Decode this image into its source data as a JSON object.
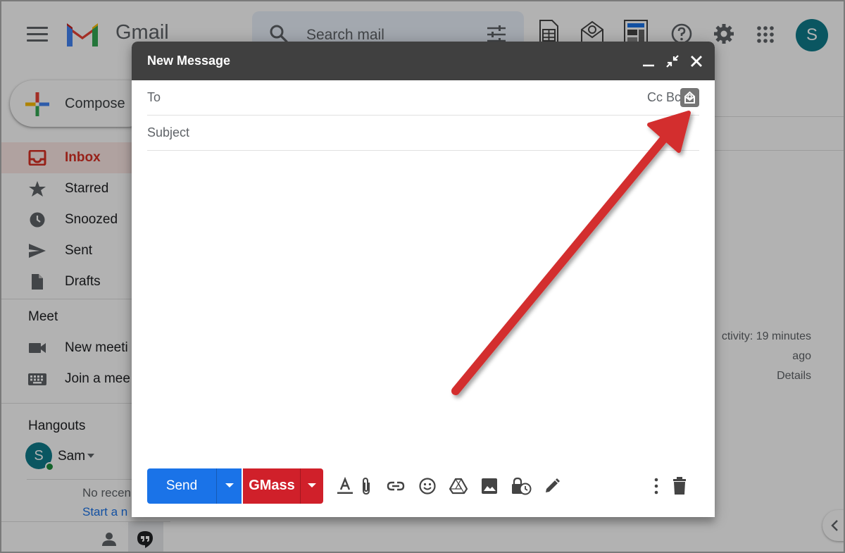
{
  "app": {
    "logo_text": "Gmail",
    "search_placeholder": "Search mail",
    "avatar_letter": "S"
  },
  "sidebar": {
    "compose_label": "Compose",
    "items": [
      {
        "label": "Inbox",
        "icon": "inbox-icon",
        "active": true
      },
      {
        "label": "Starred",
        "icon": "star-icon"
      },
      {
        "label": "Snoozed",
        "icon": "clock-icon"
      },
      {
        "label": "Sent",
        "icon": "send-icon"
      },
      {
        "label": "Drafts",
        "icon": "draft-icon"
      }
    ],
    "meet": {
      "title": "Meet",
      "new_meeting": "New meeti",
      "join_meeting": "Join a mee"
    },
    "hangouts": {
      "title": "Hangouts",
      "contact_letter": "S",
      "contact_name": "Sam",
      "no_recent": "No recen",
      "start_new": "Start a n"
    }
  },
  "main": {
    "activity_line1": "ctivity: 19 minutes",
    "activity_line2": "ago",
    "details_link": "Details"
  },
  "compose": {
    "title": "New Message",
    "to_label": "To",
    "cc_bcc": "Cc Bcc",
    "subject_placeholder": "Subject",
    "send_label": "Send",
    "gmass_label": "GMass"
  },
  "colors": {
    "send_blue": "#1a73e8",
    "gmass_red": "#d0202a",
    "arrow_red": "#d32f2f",
    "header_dark": "#404040"
  }
}
